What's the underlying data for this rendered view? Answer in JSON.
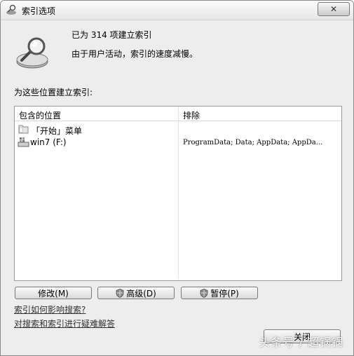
{
  "window": {
    "title": "索引选项",
    "close_symbol": "✕"
  },
  "status": {
    "line1": "已为 314 项建立索引",
    "line2": "由于用户活动，索引的速度减慢。"
  },
  "section_label": "为这些位置建立索引:",
  "table": {
    "col_included": "包含的位置",
    "col_excluded": "排除",
    "rows": [
      {
        "name": "「开始」菜单",
        "excluded": ""
      },
      {
        "name": "win7 (F:)",
        "excluded": "ProgramData; Data; AppData; AppDa..."
      }
    ]
  },
  "buttons": {
    "modify": "修改(M)",
    "advanced": "高级(D)",
    "pause": "暂停(P)",
    "close": "关闭"
  },
  "links": {
    "how_affects": "索引如何影响搜索?",
    "troubleshoot": "对搜索和索引进行疑难解答"
  },
  "watermark": "头条号 / 超锅锅"
}
